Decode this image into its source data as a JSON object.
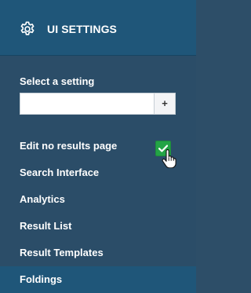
{
  "header": {
    "title": "UI SETTINGS",
    "icon": "gear-icon"
  },
  "setting_selector": {
    "label": "Select a setting",
    "value": "",
    "add_button_label": "+"
  },
  "menu": {
    "items": [
      {
        "label": "Edit no results page",
        "checked": true
      },
      {
        "label": "Search Interface"
      },
      {
        "label": "Analytics"
      },
      {
        "label": "Result List"
      },
      {
        "label": "Result Templates"
      },
      {
        "label": "Foldings",
        "selected": true
      }
    ]
  },
  "colors": {
    "header_bg": "#1f5679",
    "panel_bg": "#2b4d68",
    "checkbox_green": "#23a446",
    "text": "#ffffff"
  }
}
